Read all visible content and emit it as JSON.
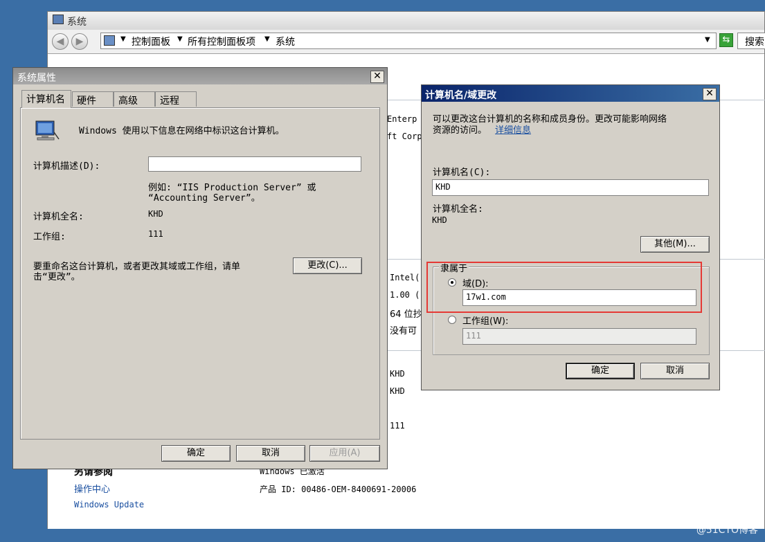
{
  "background_window": {
    "title": "系统",
    "breadcrumb": [
      "控制面板",
      "所有控制面板项",
      "系统"
    ],
    "search_label": "搜索",
    "fragments": {
      "enterp": "Enterp",
      "ft_corp": "ft Corp",
      "intel": "Intel(",
      "ghz": "1.00 (",
      "bits": "64 位抄",
      "no_pen": "没有可"
    },
    "computer_name": "KHD",
    "full_name": "KHD",
    "workgroup": "111",
    "see_also": "另请参阅",
    "action_center": "操作中心",
    "windows_update": "Windows Update",
    "activation": "Windows 已激活",
    "product_id": "产品 ID: 00486-OEM-8400691-20006"
  },
  "system_properties": {
    "title": "系统属性",
    "tabs": [
      "计算机名",
      "硬件",
      "高级",
      "远程"
    ],
    "intro": "Windows 使用以下信息在网络中标识这台计算机。",
    "description_label": "计算机描述(D):",
    "description_value": "",
    "example_line1": "例如: “IIS Production Server” 或",
    "example_line2": "“Accounting Server”。",
    "full_name_label": "计算机全名:",
    "full_name_value": "KHD",
    "workgroup_label": "工作组:",
    "workgroup_value": "111",
    "rename_line1": "要重命名这台计算机，或者更改其域或工作组，请单",
    "rename_line2": "击“更改”。",
    "change_button": "更改(C)...",
    "ok": "确定",
    "cancel": "取消",
    "apply": "应用(A)"
  },
  "domain_dialog": {
    "title": "计算机名/域更改",
    "desc_line1": "可以更改这台计算机的名称和成员身份。更改可能影响网络",
    "desc_line2": "资源的访问。",
    "details_link": "详细信息",
    "computer_name_label": "计算机名(C):",
    "computer_name_value": "KHD",
    "full_name_label": "计算机全名:",
    "full_name_value": "KHD",
    "more_button": "其他(M)...",
    "member_of_label": "隶属于",
    "domain_label": "域(D):",
    "domain_value": "17w1.com",
    "domain_selected": true,
    "workgroup_label": "工作组(W):",
    "workgroup_value": "111",
    "ok": "确定",
    "cancel": "取消"
  },
  "colors": {
    "desktop": "#3a6ea5",
    "active_title": "#0a246a",
    "highlight": "#e53935"
  },
  "watermark": "@51CTO博客"
}
